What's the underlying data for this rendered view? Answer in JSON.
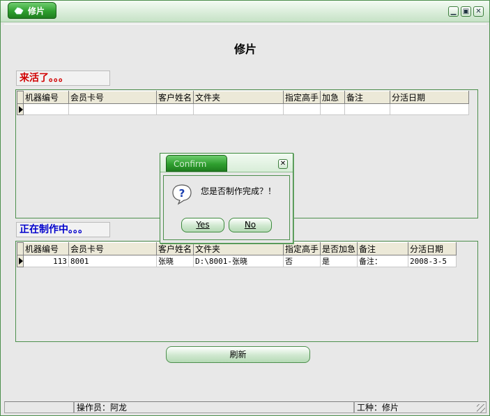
{
  "window": {
    "title": "修片",
    "app_icon": "hand-icon"
  },
  "page": {
    "title": "修片"
  },
  "incoming": {
    "label": "来活了。。。",
    "columns": [
      "机器编号",
      "会员卡号",
      "客户姓名",
      "文件夹",
      "指定高手",
      "加急",
      "备注",
      "分活日期"
    ],
    "rows": [
      [
        "",
        "",
        "",
        "",
        "",
        "",
        "",
        ""
      ]
    ]
  },
  "inprogress": {
    "label": "正在制作中。。。",
    "columns": [
      "机器编号",
      "会员卡号",
      "客户姓名",
      "文件夹",
      "指定高手",
      "是否加急",
      "备注",
      "分活日期"
    ],
    "rows": [
      [
        "113",
        "8001",
        "张晓",
        "D:\\8001-张晓",
        "否",
        "是",
        "备注：",
        "2008-3-5"
      ]
    ]
  },
  "refresh_button": "刷新",
  "statusbar": {
    "operator": "操作员：阿龙",
    "job_type": "工种：修片"
  },
  "dialog": {
    "title": "Confirm",
    "message": "您是否制作完成？！",
    "yes_label": "Yes",
    "no_label": "No"
  },
  "colors": {
    "accent_green": "#2f9f2f",
    "label_red": "#d00000",
    "label_blue": "#0000cc"
  }
}
